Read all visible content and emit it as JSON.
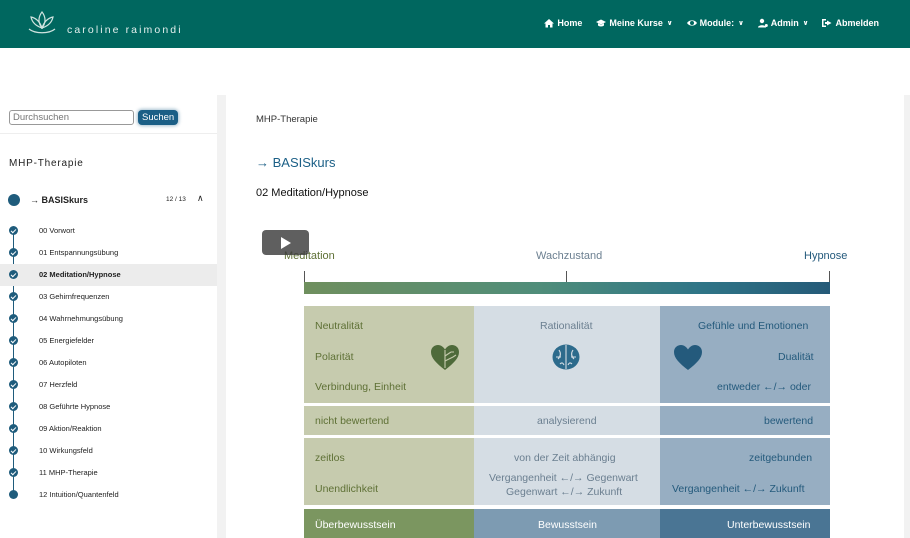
{
  "brand": {
    "name": "caroline raimondi"
  },
  "nav": [
    {
      "label": "Home",
      "icon": "home-icon",
      "dropdown": false
    },
    {
      "label": "Meine Kurse",
      "icon": "graduation-cap-icon",
      "dropdown": true
    },
    {
      "label": "Module:",
      "icon": "eye-icon",
      "dropdown": true
    },
    {
      "label": "Admin",
      "icon": "user-gear-icon",
      "dropdown": true
    },
    {
      "label": "Abmelden",
      "icon": "sign-out-icon",
      "dropdown": false
    }
  ],
  "sidebar": {
    "search_placeholder": "Durchsuchen",
    "search_button": "Suchen",
    "course_title": "MHP-Therapie",
    "module": {
      "name": "→ BASISkurs",
      "count": "12 / 13"
    },
    "lessons": [
      {
        "label": "00 Vorwort",
        "done": true
      },
      {
        "label": "01 Entspannungsübung",
        "done": true
      },
      {
        "label": "02 Meditation/Hypnose",
        "done": true,
        "active": true
      },
      {
        "label": "03 Gehirnfrequenzen",
        "done": true
      },
      {
        "label": "04 Wahrnehmungsübung",
        "done": true
      },
      {
        "label": "05 Energiefelder",
        "done": true
      },
      {
        "label": "06 Autopiloten",
        "done": true
      },
      {
        "label": "07 Herzfeld",
        "done": true
      },
      {
        "label": "08 Geführte Hypnose",
        "done": true
      },
      {
        "label": "09 Aktion/Reaktion",
        "done": true
      },
      {
        "label": "10 Wirkungsfeld",
        "done": true
      },
      {
        "label": "11 MHP-Therapie",
        "done": true
      },
      {
        "label": "12 Intuition/Quantenfeld",
        "done": false
      }
    ]
  },
  "main": {
    "breadcrumb": "MHP-Therapie",
    "course_title": "→ BASISkurs",
    "lesson_title": "02 Meditation/Hypnose"
  },
  "figure": {
    "scale": {
      "left": "Meditation",
      "middle": "Wachzustand",
      "right": "Hypnose"
    },
    "row1": {
      "a1": "Neutralität",
      "a2": "Polarität",
      "a3": "Verbindung, Einheit",
      "b1": "Rationalität",
      "c1": "Gefühle und Emotionen",
      "c2": "Dualität",
      "c3": "entweder ←/→ oder"
    },
    "row2": {
      "a": "nicht bewertend",
      "b": "analysierend",
      "c": "bewertend"
    },
    "row3": {
      "a1": "zeitlos",
      "a2": "Unendlichkeit",
      "b1": "von der Zeit abhängig",
      "b2": "Vergangenheit ←/→ Gegenwart",
      "b3": "Gegenwart ←/→ Zukunft",
      "c1": "zeitgebunden",
      "c2": "Vergangenheit ←/→ Zukunft"
    },
    "footer": {
      "a": "Überbewusstsein",
      "b": "Bewusstsein",
      "c": "Unterbewusstsein"
    },
    "colors": {
      "green": "#7b9660",
      "blue": "#4a7594",
      "teal": "#00675f"
    }
  }
}
